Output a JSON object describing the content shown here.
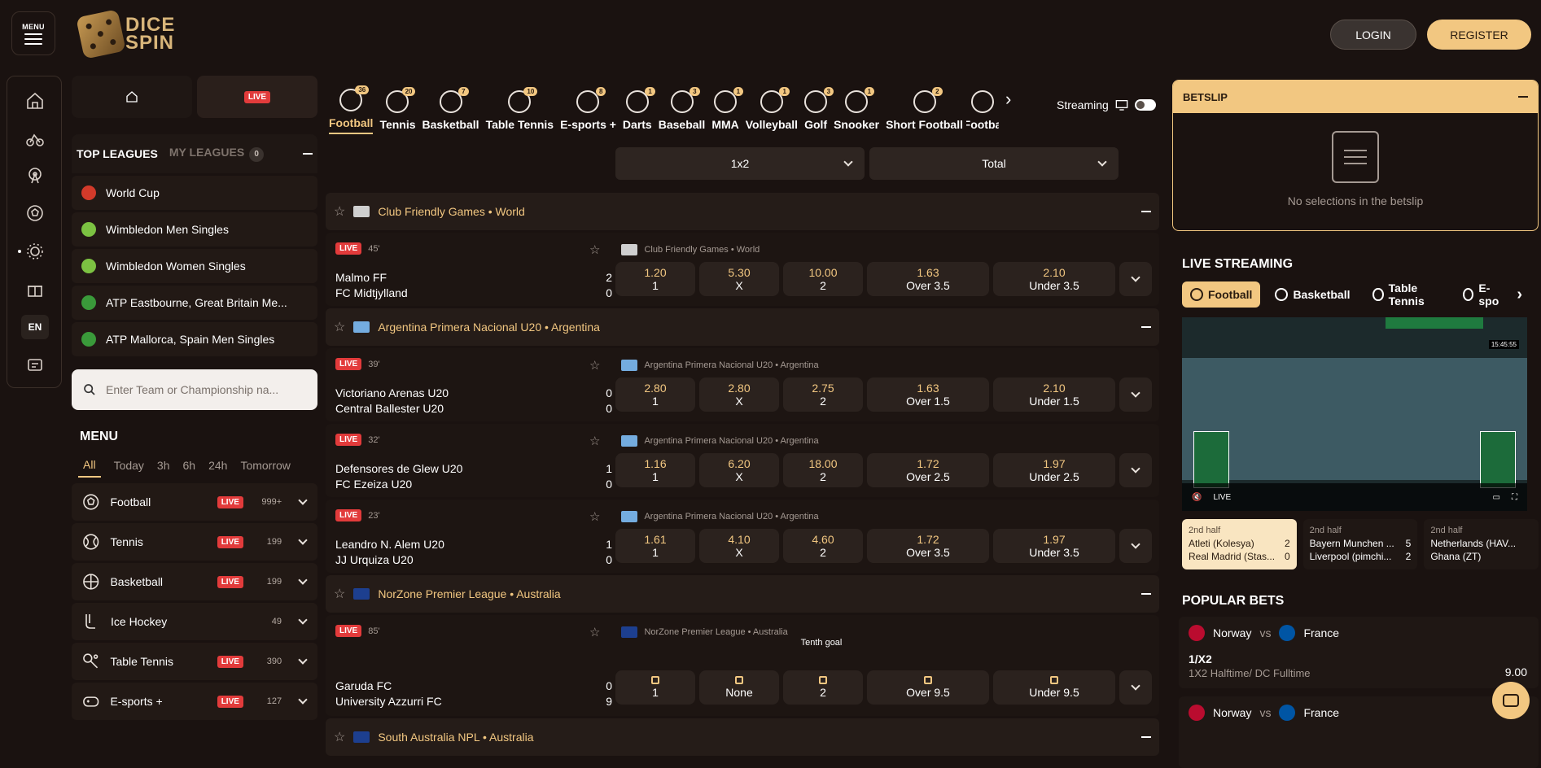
{
  "header": {
    "menu_label": "MENU",
    "logo_top": "DICE",
    "logo_bottom": "SPIN",
    "login": "LOGIN",
    "register": "REGISTER"
  },
  "rail": {
    "lang": "EN"
  },
  "left": {
    "live_tab": "LIVE",
    "top_leagues": "TOP LEAGUES",
    "my_leagues": "MY LEAGUES",
    "my_leagues_count": "0",
    "leagues": [
      {
        "name": "World Cup",
        "color": "#d23a2a"
      },
      {
        "name": "Wimbledon Men Singles",
        "color": "#7cc242"
      },
      {
        "name": "Wimbledon Women Singles",
        "color": "#7cc242"
      },
      {
        "name": "ATP Eastbourne, Great Britain Me...",
        "color": "#3a9a3a"
      },
      {
        "name": "ATP Mallorca, Spain Men Singles",
        "color": "#3a9a3a"
      }
    ],
    "search_placeholder": "Enter Team or Championship na...",
    "menu_title": "MENU",
    "time_tabs": [
      "All",
      "Today",
      "3h",
      "6h",
      "24h",
      "Tomorrow"
    ],
    "sports": [
      {
        "name": "Football",
        "live": "LIVE",
        "count": "999+"
      },
      {
        "name": "Tennis",
        "live": "LIVE",
        "count": "199"
      },
      {
        "name": "Basketball",
        "live": "LIVE",
        "count": "199"
      },
      {
        "name": "Ice Hockey",
        "live": "",
        "count": "49"
      },
      {
        "name": "Table Tennis",
        "live": "LIVE",
        "count": "390"
      },
      {
        "name": "E-sports +",
        "live": "LIVE",
        "count": "127"
      }
    ]
  },
  "sports_bar": [
    {
      "name": "Football",
      "badge": "36"
    },
    {
      "name": "Tennis",
      "badge": "20"
    },
    {
      "name": "Basketball",
      "badge": "7"
    },
    {
      "name": "Table Tennis",
      "badge": "10"
    },
    {
      "name": "E-sports +",
      "badge": "8"
    },
    {
      "name": "Darts",
      "badge": "1"
    },
    {
      "name": "Baseball",
      "badge": "3"
    },
    {
      "name": "MMA",
      "badge": "1"
    },
    {
      "name": "Volleyball",
      "badge": "1"
    },
    {
      "name": "Golf",
      "badge": "3"
    },
    {
      "name": "Snooker",
      "badge": "1"
    },
    {
      "name": "Short Football",
      "badge": "2"
    },
    {
      "name": "Footba",
      "badge": ""
    }
  ],
  "streaming_label": "Streaming",
  "market_select_1": "1x2",
  "market_select_2": "Total",
  "groups": [
    {
      "name": "Club Friendly Games • World",
      "flag": "#cfcfcf",
      "matches": [
        {
          "live": "LIVE",
          "minute": "45'",
          "league": "Club Friendly Games • World",
          "home": "Malmo FF",
          "away": "FC Midtjylland",
          "hs": "2",
          "as": "0",
          "odds": [
            [
              "1.20",
              "1"
            ],
            [
              "5.30",
              "X"
            ],
            [
              "10.00",
              "2"
            ],
            [
              "1.63",
              "Over 3.5"
            ],
            [
              "2.10",
              "Under 3.5"
            ]
          ]
        }
      ]
    },
    {
      "name": "Argentina Primera Nacional U20 • Argentina",
      "flag": "#74acdf",
      "matches": [
        {
          "live": "LIVE",
          "minute": "39'",
          "league": "Argentina Primera Nacional U20 • Argentina",
          "home": "Victoriano Arenas U20",
          "away": "Central Ballester U20",
          "hs": "0",
          "as": "0",
          "odds": [
            [
              "2.80",
              "1"
            ],
            [
              "2.80",
              "X"
            ],
            [
              "2.75",
              "2"
            ],
            [
              "1.63",
              "Over 1.5"
            ],
            [
              "2.10",
              "Under 1.5"
            ]
          ]
        },
        {
          "live": "LIVE",
          "minute": "32'",
          "league": "Argentina Primera Nacional U20 • Argentina",
          "home": "Defensores de Glew U20",
          "away": "FC Ezeiza U20",
          "hs": "1",
          "as": "0",
          "odds": [
            [
              "1.16",
              "1"
            ],
            [
              "6.20",
              "X"
            ],
            [
              "18.00",
              "2"
            ],
            [
              "1.72",
              "Over 2.5"
            ],
            [
              "1.97",
              "Under 2.5"
            ]
          ]
        },
        {
          "live": "LIVE",
          "minute": "23'",
          "league": "Argentina Primera Nacional U20 • Argentina",
          "home": "Leandro N. Alem U20",
          "away": "JJ Urquiza U20",
          "hs": "1",
          "as": "0",
          "odds": [
            [
              "1.61",
              "1"
            ],
            [
              "4.10",
              "X"
            ],
            [
              "4.60",
              "2"
            ],
            [
              "1.72",
              "Over 3.5"
            ],
            [
              "1.97",
              "Under 3.5"
            ]
          ]
        }
      ]
    },
    {
      "name": "NorZone Premier League • Australia",
      "flag": "#1d3f8f",
      "matches": [
        {
          "live": "LIVE",
          "minute": "85'",
          "league": "NorZone Premier League • Australia",
          "note": "Tenth goal",
          "home": "Garuda FC",
          "away": "University Azzurri FC",
          "hs": "0",
          "as": "9",
          "odds": [
            [
              "",
              "1"
            ],
            [
              "",
              "None"
            ],
            [
              "",
              "2"
            ],
            [
              "",
              "Over 9.5"
            ],
            [
              "",
              "Under 9.5"
            ]
          ],
          "locked": true
        }
      ]
    },
    {
      "name": "South Australia NPL • Australia",
      "flag": "#1d3f8f",
      "matches": []
    }
  ],
  "betslip": {
    "title": "BETSLIP",
    "empty": "No selections in the betslip"
  },
  "live_streaming": {
    "title": "LIVE STREAMING",
    "tabs": [
      "Football",
      "Basketball",
      "Table Tennis",
      "E-spo"
    ],
    "video_live": "LIVE",
    "video_clock": "15:45:55",
    "cards": [
      {
        "half": "2nd half",
        "home": "Atleti (Kolesya)",
        "away": "Real Madrid (Stas...",
        "hs": "2",
        "as": "0"
      },
      {
        "half": "2nd half",
        "home": "Bayern Munchen ...",
        "away": "Liverpool (pimchi...",
        "hs": "5",
        "as": "2"
      },
      {
        "half": "2nd half",
        "home": "Netherlands (HAV...",
        "away": "Ghana (ZT)",
        "hs": "",
        "as": ""
      }
    ]
  },
  "popular_bets": {
    "title": "POPULAR BETS",
    "items": [
      {
        "home": "Norway",
        "vs": "vs",
        "away": "France",
        "bet": "1/X2",
        "desc": "1X2 Halftime/ DC Fulltime",
        "odd": "9.00"
      },
      {
        "home": "Norway",
        "vs": "vs",
        "away": "France",
        "bet": "",
        "desc": "",
        "odd": ""
      }
    ]
  },
  "colors": {
    "accent": "#f2c781",
    "bg": "#1a1210",
    "live": "#e23b3b"
  }
}
